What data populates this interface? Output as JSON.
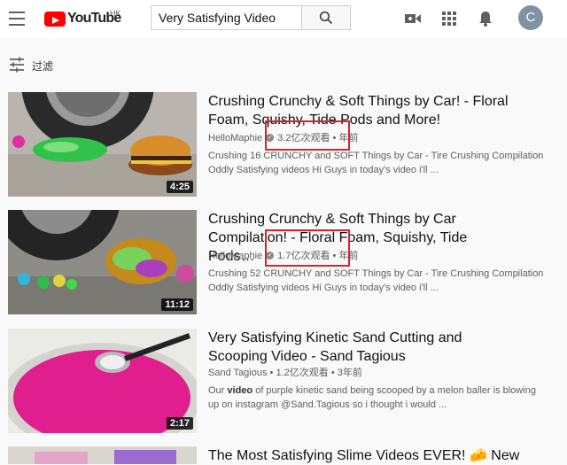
{
  "header": {
    "logo_text": "YouTube",
    "logo_region": "HK",
    "search_value": "Very Satisfying Video"
  },
  "user": {
    "avatar_letter": "C"
  },
  "filter": {
    "label": "过滤"
  },
  "videos": [
    {
      "title": "Crushing Crunchy & Soft Things by Car! - Floral Foam, Squishy, Tide Pods and More!",
      "channel": "HelloMaphie",
      "views": "3.2亿次观看",
      "age": "年前",
      "separator": "•",
      "duration": "4:25",
      "desc_line1": "Crushing 16 CRUNCHY and SOFT Things by Car - Tire Crushing Compilation",
      "desc_line2": "Oddly Satisfying videos Hi Guys in today's video i'll ..."
    },
    {
      "title": "Crushing Crunchy & Soft Things by Car Compilation! - Floral Foam, Squishy, Tide Pods…",
      "channel": "HelloMaphie",
      "views": "1.7亿次观看",
      "age": "年前",
      "separator": "•",
      "duration": "11:12",
      "desc_line1": "Crushing 52 CRUNCHY and SOFT Things by Car - Tire Crushing Compilation",
      "desc_line2": "Oddly Satisfying videos Hi Guys in today's video i'll ..."
    },
    {
      "title": "Very Satisfying Kinetic Sand Cutting and Scooping Video - Sand Tagious",
      "channel": "Sand Tagious",
      "views": "1.2亿次观看",
      "age": "3年前",
      "separator": "•",
      "duration": "2:17",
      "desc_pre": "Our ",
      "desc_bold": "video",
      "desc_post": " of purple kinetic sand being scooped by a melon baller is blowing",
      "desc_line2": "up on instagram @Sand.Tagious so i thought i would ..."
    },
    {
      "title": "The Most Satisfying Slime Videos EVER! 🧀 New"
    }
  ]
}
